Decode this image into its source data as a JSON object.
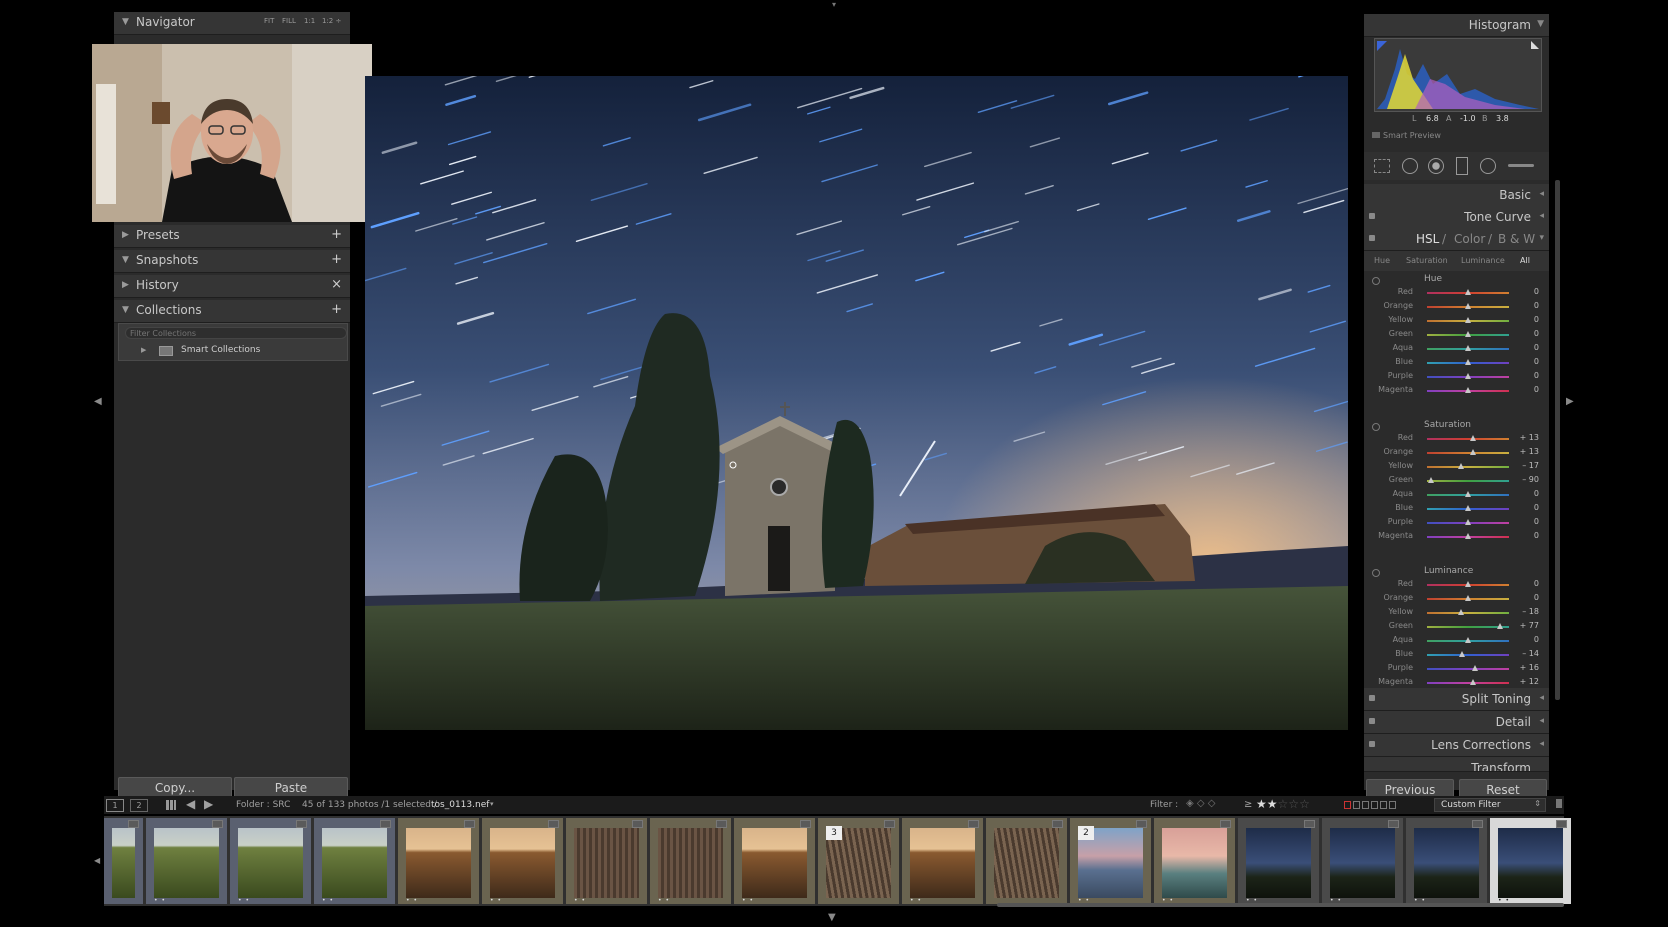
{
  "left_panel": {
    "navigator": {
      "title": "Navigator",
      "modes": [
        "FIT",
        "FILL",
        "1:1",
        "1:2 ÷"
      ]
    },
    "presets": {
      "title": "Presets",
      "action": "+"
    },
    "snapshots": {
      "title": "Snapshots",
      "action": "+"
    },
    "history": {
      "title": "History",
      "action": "×"
    },
    "collections": {
      "title": "Collections",
      "action": "+",
      "search_placeholder": "Filter Collections",
      "smart_collections": "Smart Collections"
    },
    "copy_button": "Copy...",
    "paste_button": "Paste"
  },
  "right_panel": {
    "histogram": {
      "title": "Histogram",
      "readout": {
        "l_label": "L",
        "l_value": "6.8",
        "a_label": "A",
        "a_value": "-1.0",
        "b_label": "B",
        "b_value": "3.8"
      },
      "smart_preview": "Smart Preview"
    },
    "sections": {
      "basic": "Basic",
      "tone_curve": "Tone Curve",
      "split_toning": "Split Toning",
      "detail": "Detail",
      "lens_corrections": "Lens Corrections",
      "transform": "Transform"
    },
    "hsl": {
      "title_hsl": "HSL",
      "sep1": "/",
      "title_color": "Color",
      "sep2": "/",
      "title_bw": "B & W",
      "tabs": [
        "Hue",
        "Saturation",
        "Luminance",
        "All"
      ],
      "groups": [
        {
          "title": "Hue",
          "rows": [
            {
              "label": "Red",
              "value": "0",
              "pos": 0.5
            },
            {
              "label": "Orange",
              "value": "0",
              "pos": 0.5
            },
            {
              "label": "Yellow",
              "value": "0",
              "pos": 0.5
            },
            {
              "label": "Green",
              "value": "0",
              "pos": 0.5
            },
            {
              "label": "Aqua",
              "value": "0",
              "pos": 0.5
            },
            {
              "label": "Blue",
              "value": "0",
              "pos": 0.5
            },
            {
              "label": "Purple",
              "value": "0",
              "pos": 0.5
            },
            {
              "label": "Magenta",
              "value": "0",
              "pos": 0.5
            }
          ]
        },
        {
          "title": "Saturation",
          "rows": [
            {
              "label": "Red",
              "value": "+ 13",
              "pos": 0.565
            },
            {
              "label": "Orange",
              "value": "+ 13",
              "pos": 0.565
            },
            {
              "label": "Yellow",
              "value": "– 17",
              "pos": 0.415
            },
            {
              "label": "Green",
              "value": "– 90",
              "pos": 0.05
            },
            {
              "label": "Aqua",
              "value": "0",
              "pos": 0.5
            },
            {
              "label": "Blue",
              "value": "0",
              "pos": 0.5
            },
            {
              "label": "Purple",
              "value": "0",
              "pos": 0.5
            },
            {
              "label": "Magenta",
              "value": "0",
              "pos": 0.5
            }
          ]
        },
        {
          "title": "Luminance",
          "rows": [
            {
              "label": "Red",
              "value": "0",
              "pos": 0.5
            },
            {
              "label": "Orange",
              "value": "0",
              "pos": 0.5
            },
            {
              "label": "Yellow",
              "value": "– 18",
              "pos": 0.41
            },
            {
              "label": "Green",
              "value": "+ 77",
              "pos": 0.885
            },
            {
              "label": "Aqua",
              "value": "0",
              "pos": 0.5
            },
            {
              "label": "Blue",
              "value": "– 14",
              "pos": 0.43
            },
            {
              "label": "Purple",
              "value": "+ 16",
              "pos": 0.58
            },
            {
              "label": "Magenta",
              "value": "+ 12",
              "pos": 0.56
            }
          ]
        }
      ]
    },
    "previous_button": "Previous",
    "reset_button": "Reset"
  },
  "toolbar": {
    "page1": "1",
    "page2": "2",
    "folder": "Folder : SRC",
    "count": "45 of 133 photos /1 selected /",
    "filename": "tos_0113.nef",
    "filter_label": "Filter :",
    "rating_op": "≥",
    "rating": 2,
    "custom_filter": "Custom Filter"
  },
  "filmstrip": {
    "thumbs": [
      {
        "kind": "field",
        "stack": "",
        "stars": "",
        "w": 0.26
      },
      {
        "kind": "field",
        "stack": "",
        "stars": "• •",
        "w": 0.54
      },
      {
        "kind": "field",
        "stack": "",
        "stars": "• •",
        "w": 0.54
      },
      {
        "kind": "field",
        "stack": "",
        "stars": "• •",
        "w": 0.54
      },
      {
        "kind": "warm",
        "stack": "",
        "stars": "• •",
        "w": 0.54
      },
      {
        "kind": "warm",
        "stack": "",
        "stars": "• •",
        "w": 0.54
      },
      {
        "kind": "furrow",
        "stack": "",
        "stars": "• •",
        "w": 0.54
      },
      {
        "kind": "furrow",
        "stack": "",
        "stars": "• •",
        "w": 0.54
      },
      {
        "kind": "warm",
        "stack": "",
        "stars": "• •",
        "w": 0.54
      },
      {
        "kind": "furrowv",
        "stack": "3",
        "stars": "",
        "w": 0.54
      },
      {
        "kind": "warm",
        "stack": "",
        "stars": "• •",
        "w": 0.54
      },
      {
        "kind": "furrowv",
        "stack": "",
        "stars": "",
        "w": 0.54
      },
      {
        "kind": "dawn",
        "stack": "2",
        "stars": "• •",
        "w": 0.54
      },
      {
        "kind": "pink",
        "stack": "",
        "stars": "• •",
        "w": 0.54
      },
      {
        "kind": "night",
        "stack": "",
        "stars": "• •",
        "w": 0.54
      },
      {
        "kind": "night",
        "stack": "",
        "stars": "• •",
        "w": 0.54
      },
      {
        "kind": "night",
        "stack": "",
        "stars": "• •",
        "w": 0.54
      },
      {
        "kind": "night",
        "stack": "",
        "stars": "• •",
        "w": 0.54
      }
    ]
  }
}
